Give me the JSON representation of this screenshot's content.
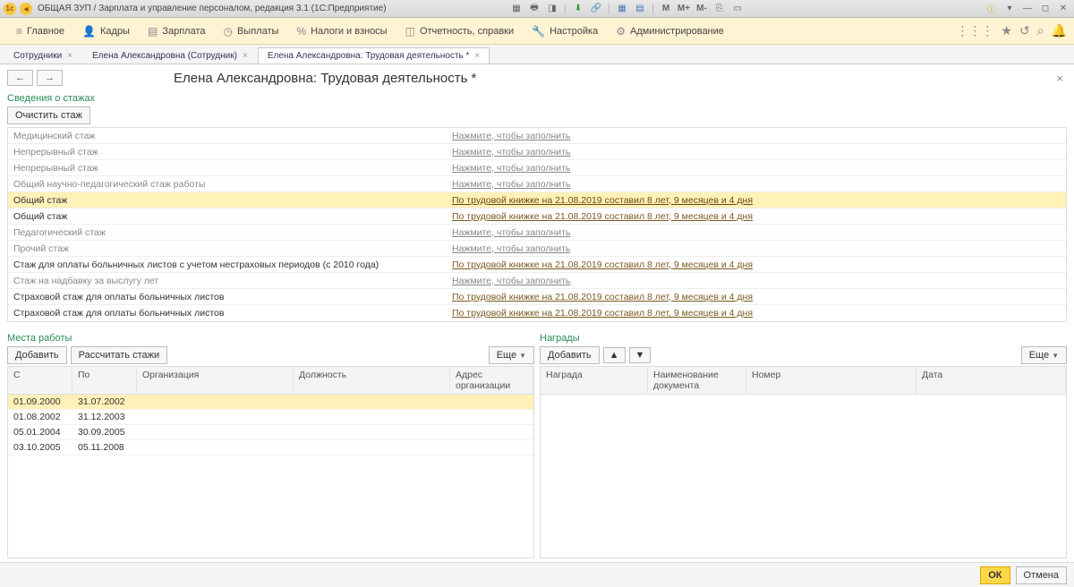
{
  "titlebar": {
    "title": "ОБЩАЯ ЗУП / Зарплата и управление персоналом, редакция 3.1  (1С:Предприятие)",
    "right_labels": {
      "m": "M",
      "mplus": "M+",
      "mminus": "M-"
    }
  },
  "mainmenu": {
    "items": [
      {
        "icon": "≡",
        "label": "Главное"
      },
      {
        "icon": "👤",
        "label": "Кадры"
      },
      {
        "icon": "📄",
        "label": "Зарплата"
      },
      {
        "icon": "⏱",
        "label": "Выплаты"
      },
      {
        "icon": "%",
        "label": "Налоги и взносы"
      },
      {
        "icon": "📊",
        "label": "Отчетность, справки"
      },
      {
        "icon": "🔧",
        "label": "Настройка"
      },
      {
        "icon": "⚙",
        "label": "Администрирование"
      }
    ]
  },
  "tabs": [
    {
      "label": "Сотрудники",
      "close": true,
      "active": false
    },
    {
      "label": "Елена Александровна (Сотрудник)",
      "close": true,
      "active": false
    },
    {
      "label": "Елена Александровна: Трудовая деятельность *",
      "close": true,
      "active": true
    }
  ],
  "page": {
    "title": "Елена Александровна: Трудовая деятельность *"
  },
  "sections": {
    "stazh": {
      "label": "Сведения о стажах",
      "clear_btn": "Очистить стаж",
      "rows": [
        {
          "name": "Медицинский стаж",
          "value": "Нажмите, чтобы заполнить",
          "filled": false,
          "active": false,
          "hl": false
        },
        {
          "name": "Непрерывный стаж",
          "value": "Нажмите, чтобы заполнить",
          "filled": false,
          "active": false,
          "hl": false
        },
        {
          "name": "Непрерывный стаж",
          "value": "Нажмите, чтобы заполнить",
          "filled": false,
          "active": false,
          "hl": false
        },
        {
          "name": "Общий научно-педагогический стаж работы",
          "value": "Нажмите, чтобы заполнить",
          "filled": false,
          "active": false,
          "hl": false
        },
        {
          "name": "Общий стаж",
          "value": "По трудовой книжке на 21.08.2019 составил 8 лет, 9 месяцев и 4 дня",
          "filled": true,
          "active": true,
          "hl": true
        },
        {
          "name": "Общий стаж",
          "value": "По трудовой книжке на 21.08.2019 составил 8 лет, 9 месяцев и 4 дня",
          "filled": true,
          "active": true,
          "hl": false
        },
        {
          "name": "Педагогический стаж",
          "value": "Нажмите, чтобы заполнить",
          "filled": false,
          "active": false,
          "hl": false
        },
        {
          "name": "Прочий стаж",
          "value": "Нажмите, чтобы заполнить",
          "filled": false,
          "active": false,
          "hl": false
        },
        {
          "name": "Стаж для оплаты больничных листов с учетом нестраховых периодов (с 2010 года)",
          "value": "По трудовой книжке на 21.08.2019 составил 8 лет, 9 месяцев и 4 дня",
          "filled": true,
          "active": true,
          "hl": false
        },
        {
          "name": "Стаж на надбавку за выслугу лет",
          "value": "Нажмите, чтобы заполнить",
          "filled": false,
          "active": false,
          "hl": false
        },
        {
          "name": "Страховой стаж для оплаты больничных листов",
          "value": "По трудовой книжке на 21.08.2019 составил 8 лет, 9 месяцев и 4 дня",
          "filled": true,
          "active": true,
          "hl": false
        },
        {
          "name": "Страховой стаж для оплаты больничных листов",
          "value": "По трудовой книжке на 21.08.2019 составил 8 лет, 9 месяцев и 4 дня",
          "filled": true,
          "active": true,
          "hl": false
        }
      ]
    },
    "places": {
      "label": "Места работы",
      "add_btn": "Добавить",
      "calc_btn": "Рассчитать стажи",
      "more_btn": "Еще",
      "headers": {
        "from": "С",
        "to": "По",
        "org": "Организация",
        "pos": "Должность",
        "addr": "Адрес организации"
      },
      "rows": [
        {
          "from": "01.09.2000",
          "to": "31.07.2002",
          "org": "",
          "pos": "",
          "addr": "",
          "sel": true
        },
        {
          "from": "01.08.2002",
          "to": "31.12.2003",
          "org": "",
          "pos": "",
          "addr": "",
          "sel": false
        },
        {
          "from": "05.01.2004",
          "to": "30.09.2005",
          "org": "",
          "pos": "",
          "addr": "",
          "sel": false
        },
        {
          "from": "03.10.2005",
          "to": "05.11.2008",
          "org": "",
          "pos": "",
          "addr": "",
          "sel": false
        }
      ]
    },
    "awards": {
      "label": "Награды",
      "add_btn": "Добавить",
      "more_btn": "Еще",
      "headers": {
        "award": "Награда",
        "doc": "Наименование документа",
        "num": "Номер",
        "date": "Дата"
      }
    }
  },
  "footer": {
    "ok": "ОК",
    "cancel": "Отмена"
  }
}
